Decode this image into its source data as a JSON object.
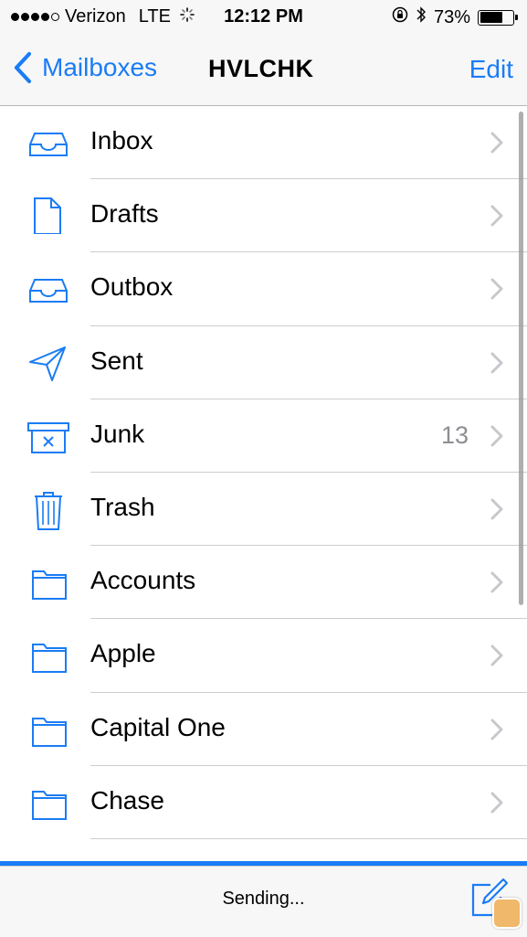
{
  "status_bar": {
    "carrier": "Verizon",
    "network": "LTE",
    "time": "12:12 PM",
    "battery": "73%",
    "battery_level": 0.73,
    "signal_bars_filled": 4,
    "signal_bars_total": 5
  },
  "nav": {
    "back_label": "Mailboxes",
    "title": "HVLCHK",
    "edit_label": "Edit"
  },
  "mailboxes": [
    {
      "label": "Inbox",
      "icon": "inbox-icon",
      "count": ""
    },
    {
      "label": "Drafts",
      "icon": "draft-document-icon",
      "count": ""
    },
    {
      "label": "Outbox",
      "icon": "outbox-icon",
      "count": ""
    },
    {
      "label": "Sent",
      "icon": "paper-plane-icon",
      "count": ""
    },
    {
      "label": "Junk",
      "icon": "junk-bin-icon",
      "count": "13"
    },
    {
      "label": "Trash",
      "icon": "trash-icon",
      "count": ""
    },
    {
      "label": "Accounts",
      "icon": "folder-icon",
      "count": ""
    },
    {
      "label": "Apple",
      "icon": "folder-icon",
      "count": ""
    },
    {
      "label": "Capital One",
      "icon": "folder-icon",
      "count": ""
    },
    {
      "label": "Chase",
      "icon": "folder-icon",
      "count": ""
    }
  ],
  "toolbar": {
    "status": "Sending..."
  },
  "colors": {
    "accent": "#1a7cf5",
    "count_gray": "#8e8e93",
    "chevron_gray": "#c7c7cc"
  }
}
